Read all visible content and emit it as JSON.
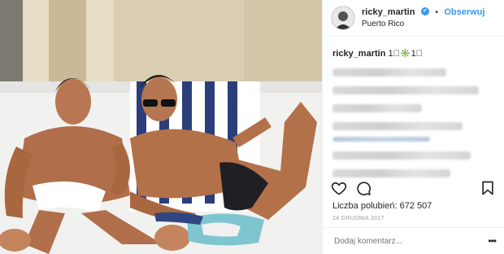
{
  "post": {
    "username": "ricky_martin",
    "verified_mark": "✔",
    "separator": "•",
    "follow_label": "Obserwuj",
    "location": "Puerto Rico",
    "caption_user": "ricky_martin",
    "caption_text": "1⃣✳️1⃣",
    "likes_label": "Liczba polubień:",
    "likes_count": "672 507",
    "date": "24 GRUDNIA 2017",
    "comment_placeholder": "Dodaj komentarz...",
    "more_label": "•••"
  },
  "icons": {
    "like": "heart-icon",
    "comment": "comment-icon",
    "save": "bookmark-icon",
    "verified": "verified-badge-icon"
  },
  "colors": {
    "link_blue": "#3897f0",
    "text": "#262626",
    "muted": "#999999"
  }
}
